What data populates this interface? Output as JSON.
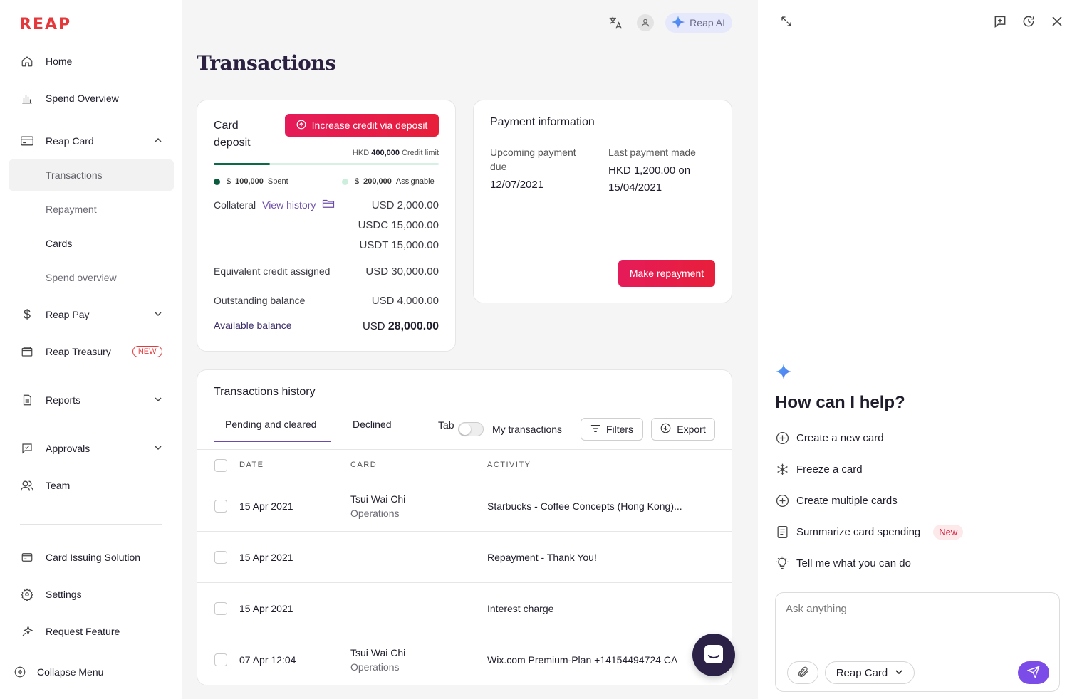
{
  "brand": {
    "logo": "REAP",
    "accent": "#e5383b",
    "purple": "#6b4aa8"
  },
  "sidebar": {
    "items": [
      {
        "label": "Home",
        "icon": "home-icon"
      },
      {
        "label": "Spend Overview",
        "icon": "bar-chart-icon"
      },
      {
        "label": "Reap Card",
        "icon": "card-icon"
      },
      {
        "label": "Reap Pay",
        "icon": "dollar-icon"
      },
      {
        "label": "Reap Treasury",
        "icon": "wallet-icon",
        "badge": "NEW"
      },
      {
        "label": "Reports",
        "icon": "report-icon"
      },
      {
        "label": "Approvals",
        "icon": "approval-icon"
      },
      {
        "label": "Team",
        "icon": "team-icon"
      },
      {
        "label": "Card Issuing Solution",
        "icon": "card-issuing-icon"
      },
      {
        "label": "Settings",
        "icon": "gear-icon"
      },
      {
        "label": "Request Feature",
        "icon": "sparkle-icon"
      }
    ],
    "reap_card_sub": [
      "Transactions",
      "Repayment",
      "Cards",
      "Spend overview"
    ],
    "collapse": "Collapse Menu"
  },
  "topbar": {
    "reap_ai": "Reap AI"
  },
  "page": {
    "title": "Transactions"
  },
  "deposit": {
    "title": "Card deposit",
    "increase_btn": "Increase credit via deposit",
    "credit_limit_currency": "HKD",
    "credit_limit_amount": "400,000",
    "credit_limit_label": "Credit limit",
    "spent_fraction": 0.25,
    "spent_prefix": "$",
    "spent_amount": "100,000",
    "spent_label": "Spent",
    "assignable_prefix": "$",
    "assignable_amount": "200,000",
    "assignable_label": "Assignable",
    "collateral_label": "Collateral",
    "view_history": "View history",
    "collateral_values": [
      "USD 2,000.00",
      "USDC 15,000.00",
      "USDT 15,000.00"
    ],
    "equiv_label": "Equivalent credit assigned",
    "equiv_value": "USD 30,000.00",
    "outstanding_label": "Outstanding balance",
    "outstanding_value": "USD 4,000.00",
    "available_label": "Available balance",
    "available_currency": "USD",
    "available_amount": "28,000.00"
  },
  "payment": {
    "title": "Payment information",
    "upcoming_label": "Upcoming payment due",
    "upcoming_value": "12/07/2021",
    "last_label": "Last payment made",
    "last_value": "HKD 1,200.00 on 15/04/2021",
    "repay_btn": "Make repayment"
  },
  "history": {
    "title": "Transactions history",
    "tabs": [
      "Pending and cleared",
      "Declined"
    ],
    "tab_label": "Tab",
    "my_transactions": "My transactions",
    "filters": "Filters",
    "export": "Export",
    "columns": [
      "DATE",
      "CARD",
      "ACTIVITY"
    ],
    "rows": [
      {
        "date": "15 Apr 2021",
        "card_name": "Tsui Wai Chi",
        "card_team": "Operations",
        "activity": "Starbucks - Coffee Concepts (Hong Kong)..."
      },
      {
        "date": "15 Apr 2021",
        "card_name": "",
        "card_team": "",
        "activity": "Repayment - Thank You!"
      },
      {
        "date": "15 Apr 2021",
        "card_name": "",
        "card_team": "",
        "activity": "Interest charge"
      },
      {
        "date": "07 Apr 12:04",
        "card_name": "Tsui Wai Chi",
        "card_team": "Operations",
        "activity": "Wix.com Premium-Plan +14154494724 CA"
      }
    ]
  },
  "ai": {
    "heading": "How can I help?",
    "suggestions": [
      {
        "label": "Create a new card",
        "icon": "plus-circle-icon"
      },
      {
        "label": "Freeze a card",
        "icon": "snowflake-icon"
      },
      {
        "label": "Create multiple cards",
        "icon": "plus-circle-icon"
      },
      {
        "label": "Summarize card spending",
        "icon": "document-icon",
        "badge": "New"
      },
      {
        "label": "Tell me what you can do",
        "icon": "lightbulb-icon"
      }
    ],
    "input_placeholder": "Ask anything",
    "context": "Reap Card"
  }
}
